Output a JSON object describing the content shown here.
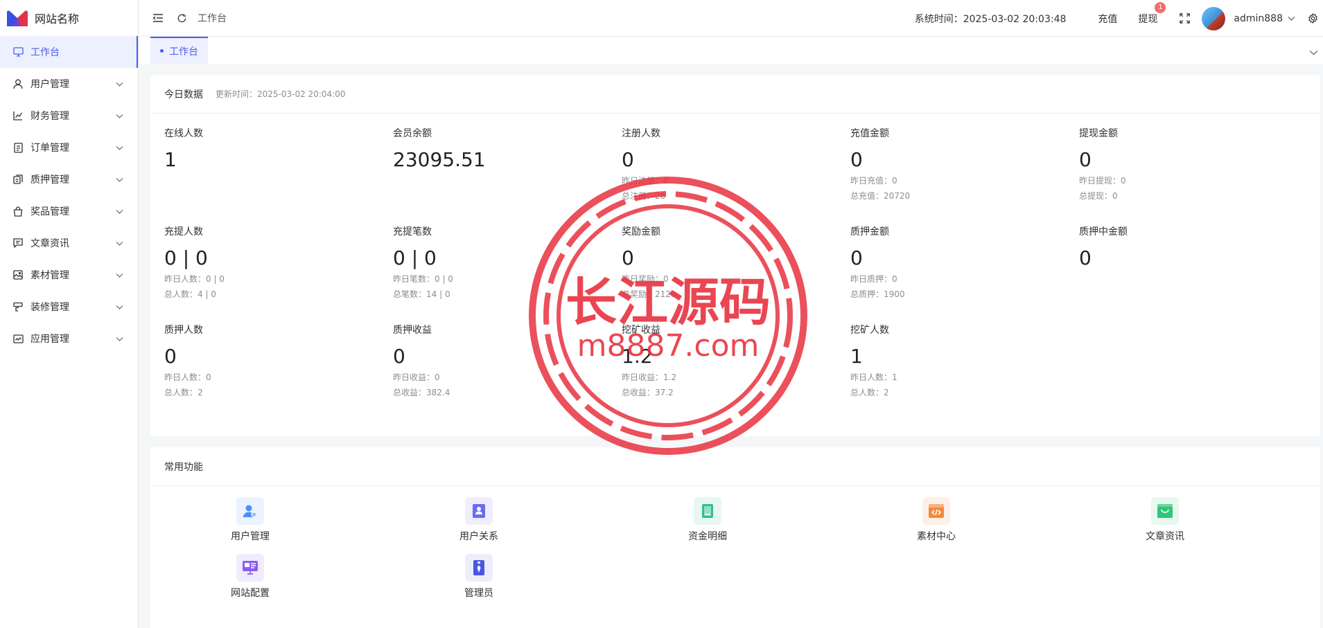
{
  "brand": {
    "name": "网站名称"
  },
  "sidebar": {
    "items": [
      {
        "label": "工作台",
        "icon": "monitor-icon",
        "active": true
      },
      {
        "label": "用户管理",
        "icon": "user-icon"
      },
      {
        "label": "财务管理",
        "icon": "chart-icon"
      },
      {
        "label": "订单管理",
        "icon": "order-icon"
      },
      {
        "label": "质押管理",
        "icon": "pledge-icon"
      },
      {
        "label": "奖品管理",
        "icon": "bag-icon"
      },
      {
        "label": "文章资讯",
        "icon": "message-icon"
      },
      {
        "label": "素材管理",
        "icon": "image-icon"
      },
      {
        "label": "装修管理",
        "icon": "paint-icon"
      },
      {
        "label": "应用管理",
        "icon": "app-icon"
      }
    ]
  },
  "header": {
    "breadcrumb": "工作台",
    "system_time": "系统时间：2025-03-02 20:03:48",
    "recharge": "充值",
    "withdraw": "提现",
    "withdraw_badge": "1",
    "username": "admin888"
  },
  "tabs": [
    {
      "label": "工作台"
    }
  ],
  "today": {
    "title": "今日数据",
    "updated": "更新时间：2025-03-02 20:04:00",
    "stats": [
      {
        "label": "在线人数",
        "value": "1",
        "details": []
      },
      {
        "label": "会员余额",
        "value": "23095.51",
        "details": []
      },
      {
        "label": "注册人数",
        "value": "0",
        "details": [
          "昨日注册：0",
          "总注册：26"
        ]
      },
      {
        "label": "充值金额",
        "value": "0",
        "details": [
          "昨日充值：0",
          "总充值：20720"
        ]
      },
      {
        "label": "提现金额",
        "value": "0",
        "details": [
          "昨日提现：0",
          "总提现：0"
        ]
      },
      {
        "label": "充提人数",
        "value": "0 | 0",
        "details": [
          "昨日人数：0 | 0",
          "总人数：4 | 0"
        ]
      },
      {
        "label": "充提笔数",
        "value": "0 | 0",
        "details": [
          "昨日笔数：0 | 0",
          "总笔数：14 | 0"
        ]
      },
      {
        "label": "奖励金额",
        "value": "0",
        "details": [
          "昨日奖励：0",
          "总奖励：2120"
        ]
      },
      {
        "label": "质押金额",
        "value": "0",
        "details": [
          "昨日质押：0",
          "总质押：1900"
        ]
      },
      {
        "label": "质押中金额",
        "value": "0",
        "details": []
      },
      {
        "label": "质押人数",
        "value": "0",
        "details": [
          "昨日人数：0",
          "总人数：2"
        ]
      },
      {
        "label": "质押收益",
        "value": "0",
        "details": [
          "昨日收益：0",
          "总收益：382.4"
        ]
      },
      {
        "label": "挖矿收益",
        "value": "1.2",
        "details": [
          "昨日收益：1.2",
          "总收益：37.2"
        ]
      },
      {
        "label": "挖矿人数",
        "value": "1",
        "details": [
          "昨日人数：1",
          "总人数：2"
        ]
      }
    ]
  },
  "functions": {
    "title": "常用功能",
    "items": [
      {
        "label": "用户管理",
        "icon": "user-manage-icon",
        "color": "#4f8ff7",
        "bg": "#eaf3ff"
      },
      {
        "label": "用户关系",
        "icon": "user-relation-icon",
        "color": "#6c6cf0",
        "bg": "#eeeefe"
      },
      {
        "label": "资金明细",
        "icon": "fund-detail-icon",
        "color": "#2fbf8f",
        "bg": "#e8f8f1"
      },
      {
        "label": "素材中心",
        "icon": "material-center-icon",
        "color": "#f5883a",
        "bg": "#fef0e6"
      },
      {
        "label": "文章资讯",
        "icon": "article-icon",
        "color": "#2fc67a",
        "bg": "#e7f9ef"
      },
      {
        "label": "网站配置",
        "icon": "site-config-icon",
        "color": "#8a5cf0",
        "bg": "#f1ebfe"
      },
      {
        "label": "管理员",
        "icon": "admin-icon",
        "color": "#4a56e0",
        "bg": "#eceefe"
      }
    ]
  },
  "watermark": {
    "line1": "长江源码",
    "line2": "m8887.com"
  }
}
